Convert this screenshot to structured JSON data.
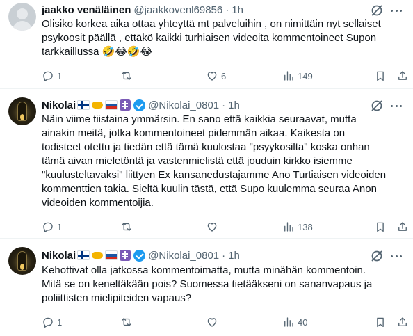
{
  "tweets": [
    {
      "name": "jaakko venäläinen",
      "handle": "@jaakkovenl69856",
      "time": "1h",
      "text": "Olisiko korkea aika ottaa yhteyttä mt palveluihin , on nimittäin nyt sellaiset\npsykoosit päällä , ettäkö kaikki turhiaisen videoita kommentoineet Supon\ntarkkaillussa 🤣😂🤣😂",
      "replies": "1",
      "retweets": "",
      "likes": "6",
      "views": "149",
      "avatar_icon": "default-avatar-icon"
    },
    {
      "name": "Nikolai",
      "handle": "@Nikolai_0801",
      "time": "1h",
      "text": "Näin viime tiistaina ymmärsin.  En sano että kaikkia seuraavat, mutta\nainakin meitä, jotka kommentoineet pidemmän aikaa.  Kaikesta on\ntodisteet otettu ja tiedän että tämä kuulostaa \"psyykosilta\" koska onhan\ntämä aivan mieletöntä ja vastenmielistä että jouduin kirkko isiemme\n\"kuulusteltavaksi\" liittyen Ex kansanedustajamme Ano Turtiaisen videoiden\nkommenttien takia. Sieltä kuulin tästä, että Supo kuulemma seuraa Anon\nvideoiden kommentoijia.",
      "replies": "1",
      "retweets": "",
      "likes": "",
      "views": "138",
      "avatar_icon": "candle-icon-avatar"
    },
    {
      "name": "Nikolai",
      "handle": "@Nikolai_0801",
      "time": "1h",
      "text": "Kehottivat olla jatkossa kommentoimatta, mutta minähän kommentoin.\nMitä se on keneltäkään pois? Suomessa tietääkseni on sananvapaus ja\npoliittisten mielipiteiden vapaus?",
      "replies": "1",
      "retweets": "",
      "likes": "",
      "views": "40",
      "avatar_icon": "candle-icon-avatar"
    }
  ],
  "badges": [
    "finland-flag-icon",
    "handshake-icon",
    "russia-flag-icon",
    "orthodox-cross-icon",
    "verified-icon"
  ],
  "colors": {
    "text": "#0f1419",
    "muted": "#536471",
    "verified": "#1d9bf0",
    "border": "#eff3f4"
  }
}
